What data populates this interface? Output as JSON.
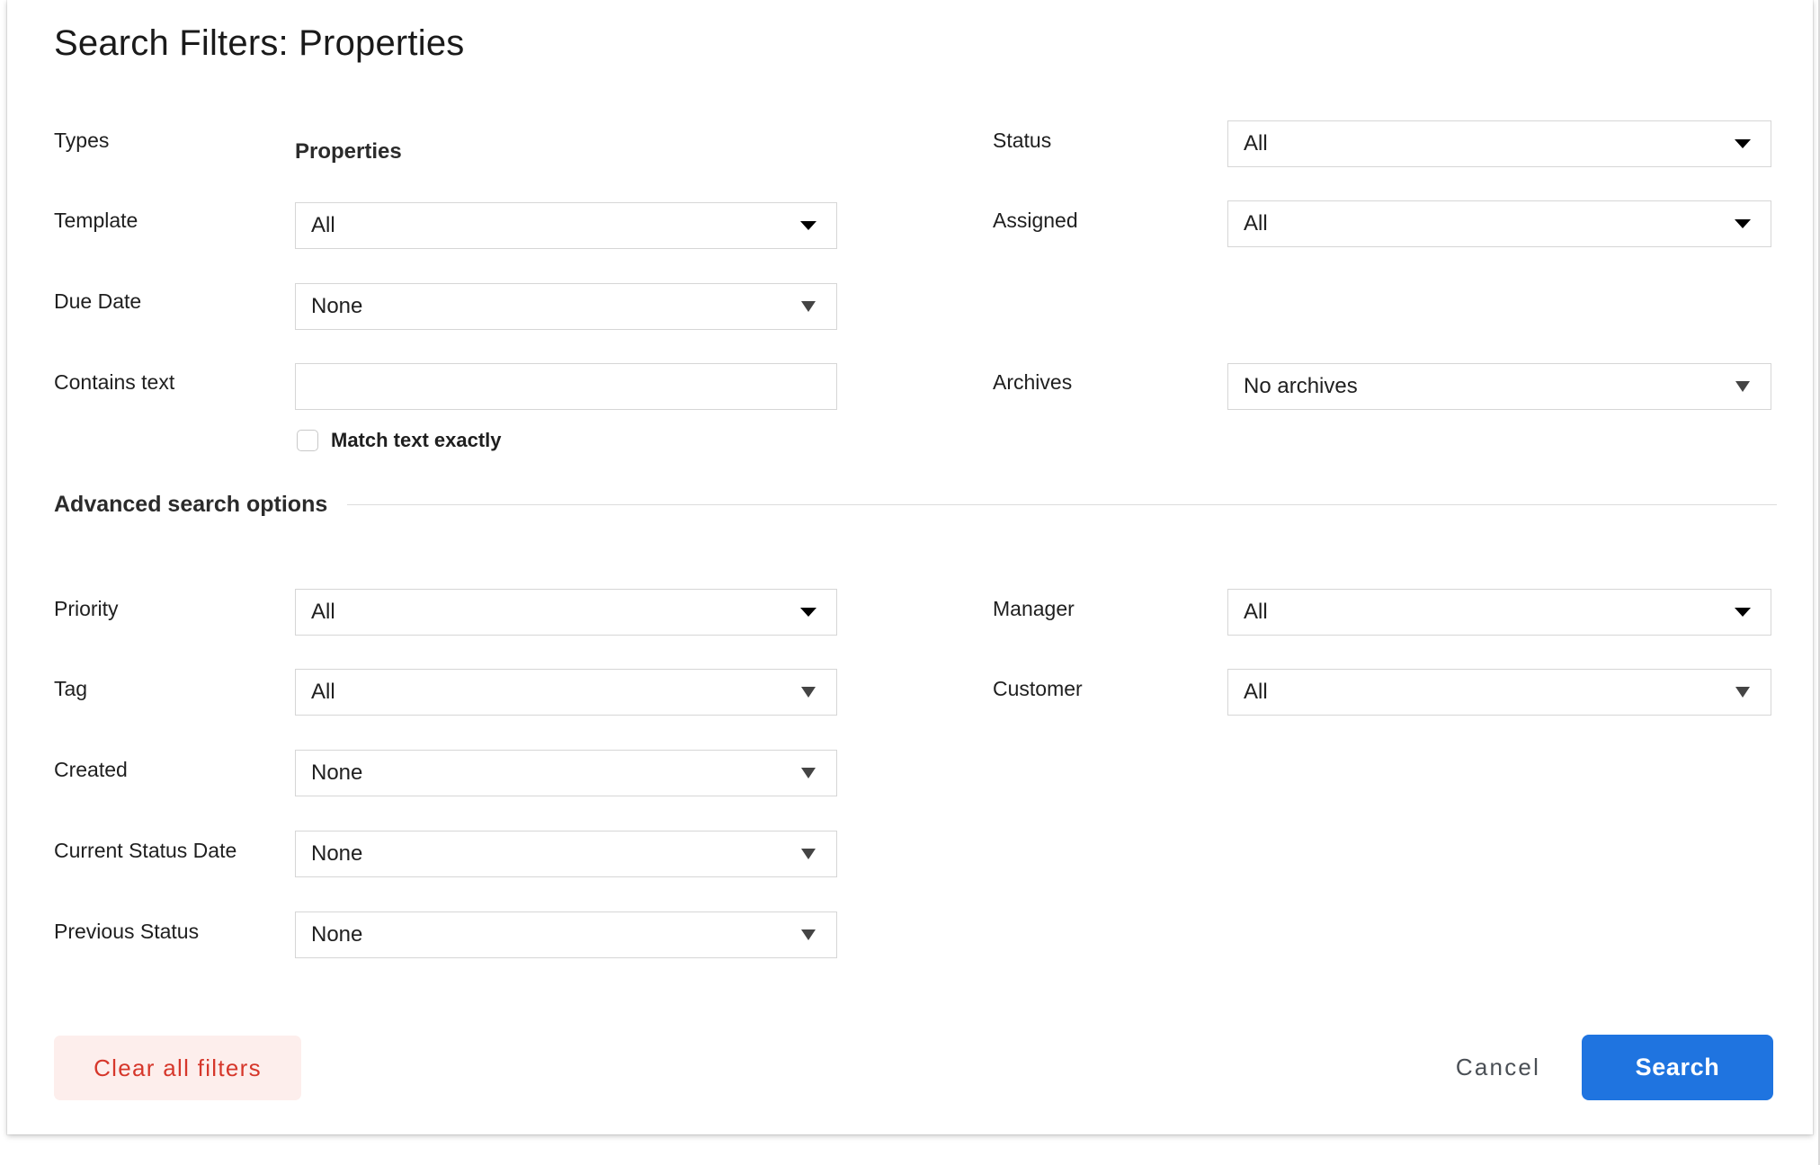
{
  "dialog": {
    "title": "Search Filters: Properties"
  },
  "left_column": {
    "types": {
      "label": "Types",
      "value": "Properties"
    },
    "template": {
      "label": "Template",
      "value": "All",
      "arrow": "chevron-down-icon"
    },
    "due_date": {
      "label": "Due Date",
      "value": "None",
      "arrow": "chevron-down-icon"
    },
    "contains_text": {
      "label": "Contains text",
      "value": "",
      "placeholder": ""
    },
    "match_exactly": {
      "label": "Match text exactly",
      "checked": false
    }
  },
  "right_column": {
    "status": {
      "label": "Status",
      "value": "All",
      "arrow": "chevron-down-icon"
    },
    "assigned": {
      "label": "Assigned",
      "value": "All",
      "arrow": "chevron-down-icon"
    },
    "archives": {
      "label": "Archives",
      "value": "No archives",
      "arrow": "chevron-down-icon"
    }
  },
  "advanced": {
    "header": "Advanced search options",
    "left": {
      "priority": {
        "label": "Priority",
        "value": "All"
      },
      "tag": {
        "label": "Tag",
        "value": "All"
      },
      "created": {
        "label": "Created",
        "value": "None"
      },
      "current_status_date": {
        "label": "Current Status Date",
        "value": "None"
      },
      "previous_status": {
        "label": "Previous Status",
        "value": "None"
      }
    },
    "right": {
      "manager": {
        "label": "Manager",
        "value": "All"
      },
      "customer": {
        "label": "Customer",
        "value": "All"
      }
    }
  },
  "footer": {
    "clear_all": "Clear all filters",
    "cancel": "Cancel",
    "search": "Search"
  },
  "colors": {
    "primary_button": "#1f74e0",
    "clear_text": "#d6372b",
    "clear_bg": "#fdeeec",
    "border": "#d6d6d6"
  }
}
